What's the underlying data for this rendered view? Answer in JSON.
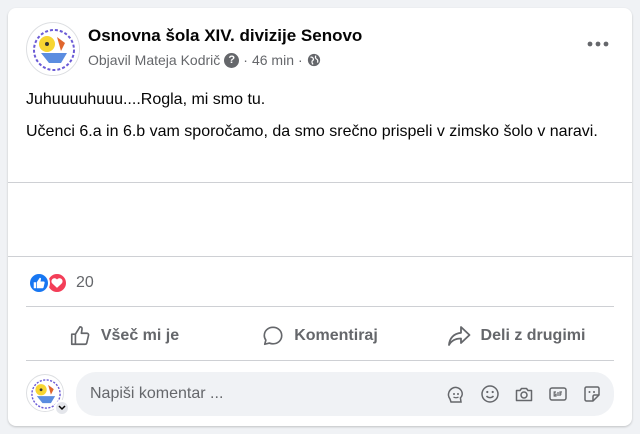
{
  "post": {
    "page_name": "Osnovna šola XIV. divizije Senovo",
    "author_line": "Objavil Mateja Kodrič",
    "help_icon_glyph": "?",
    "time": "46 min",
    "separator": "·",
    "privacy_icon": "globe-icon",
    "text": [
      "Juhuuuuhuuu....Rogla, mi smo tu.",
      "Učenci 6.a in 6.b vam sporočamo, da smo srečno prispeli v zimsko šolo v naravi."
    ]
  },
  "reactions": {
    "types": [
      "like-icon",
      "love-icon"
    ],
    "count": "20"
  },
  "actions": {
    "like_label": "Všeč mi je",
    "comment_label": "Komentiraj",
    "share_label": "Deli z drugimi"
  },
  "comment": {
    "placeholder": "Napiši komentar ...",
    "tools": [
      "sticker-avatar-icon",
      "emoji-icon",
      "camera-icon",
      "gif-icon",
      "sticker-icon"
    ]
  },
  "colors": {
    "background": "#f0f2f5",
    "card": "#ffffff",
    "primary_text": "#050505",
    "secondary_text": "#65676b",
    "like_blue": "#1877f2",
    "love_red": "#f33e58"
  }
}
